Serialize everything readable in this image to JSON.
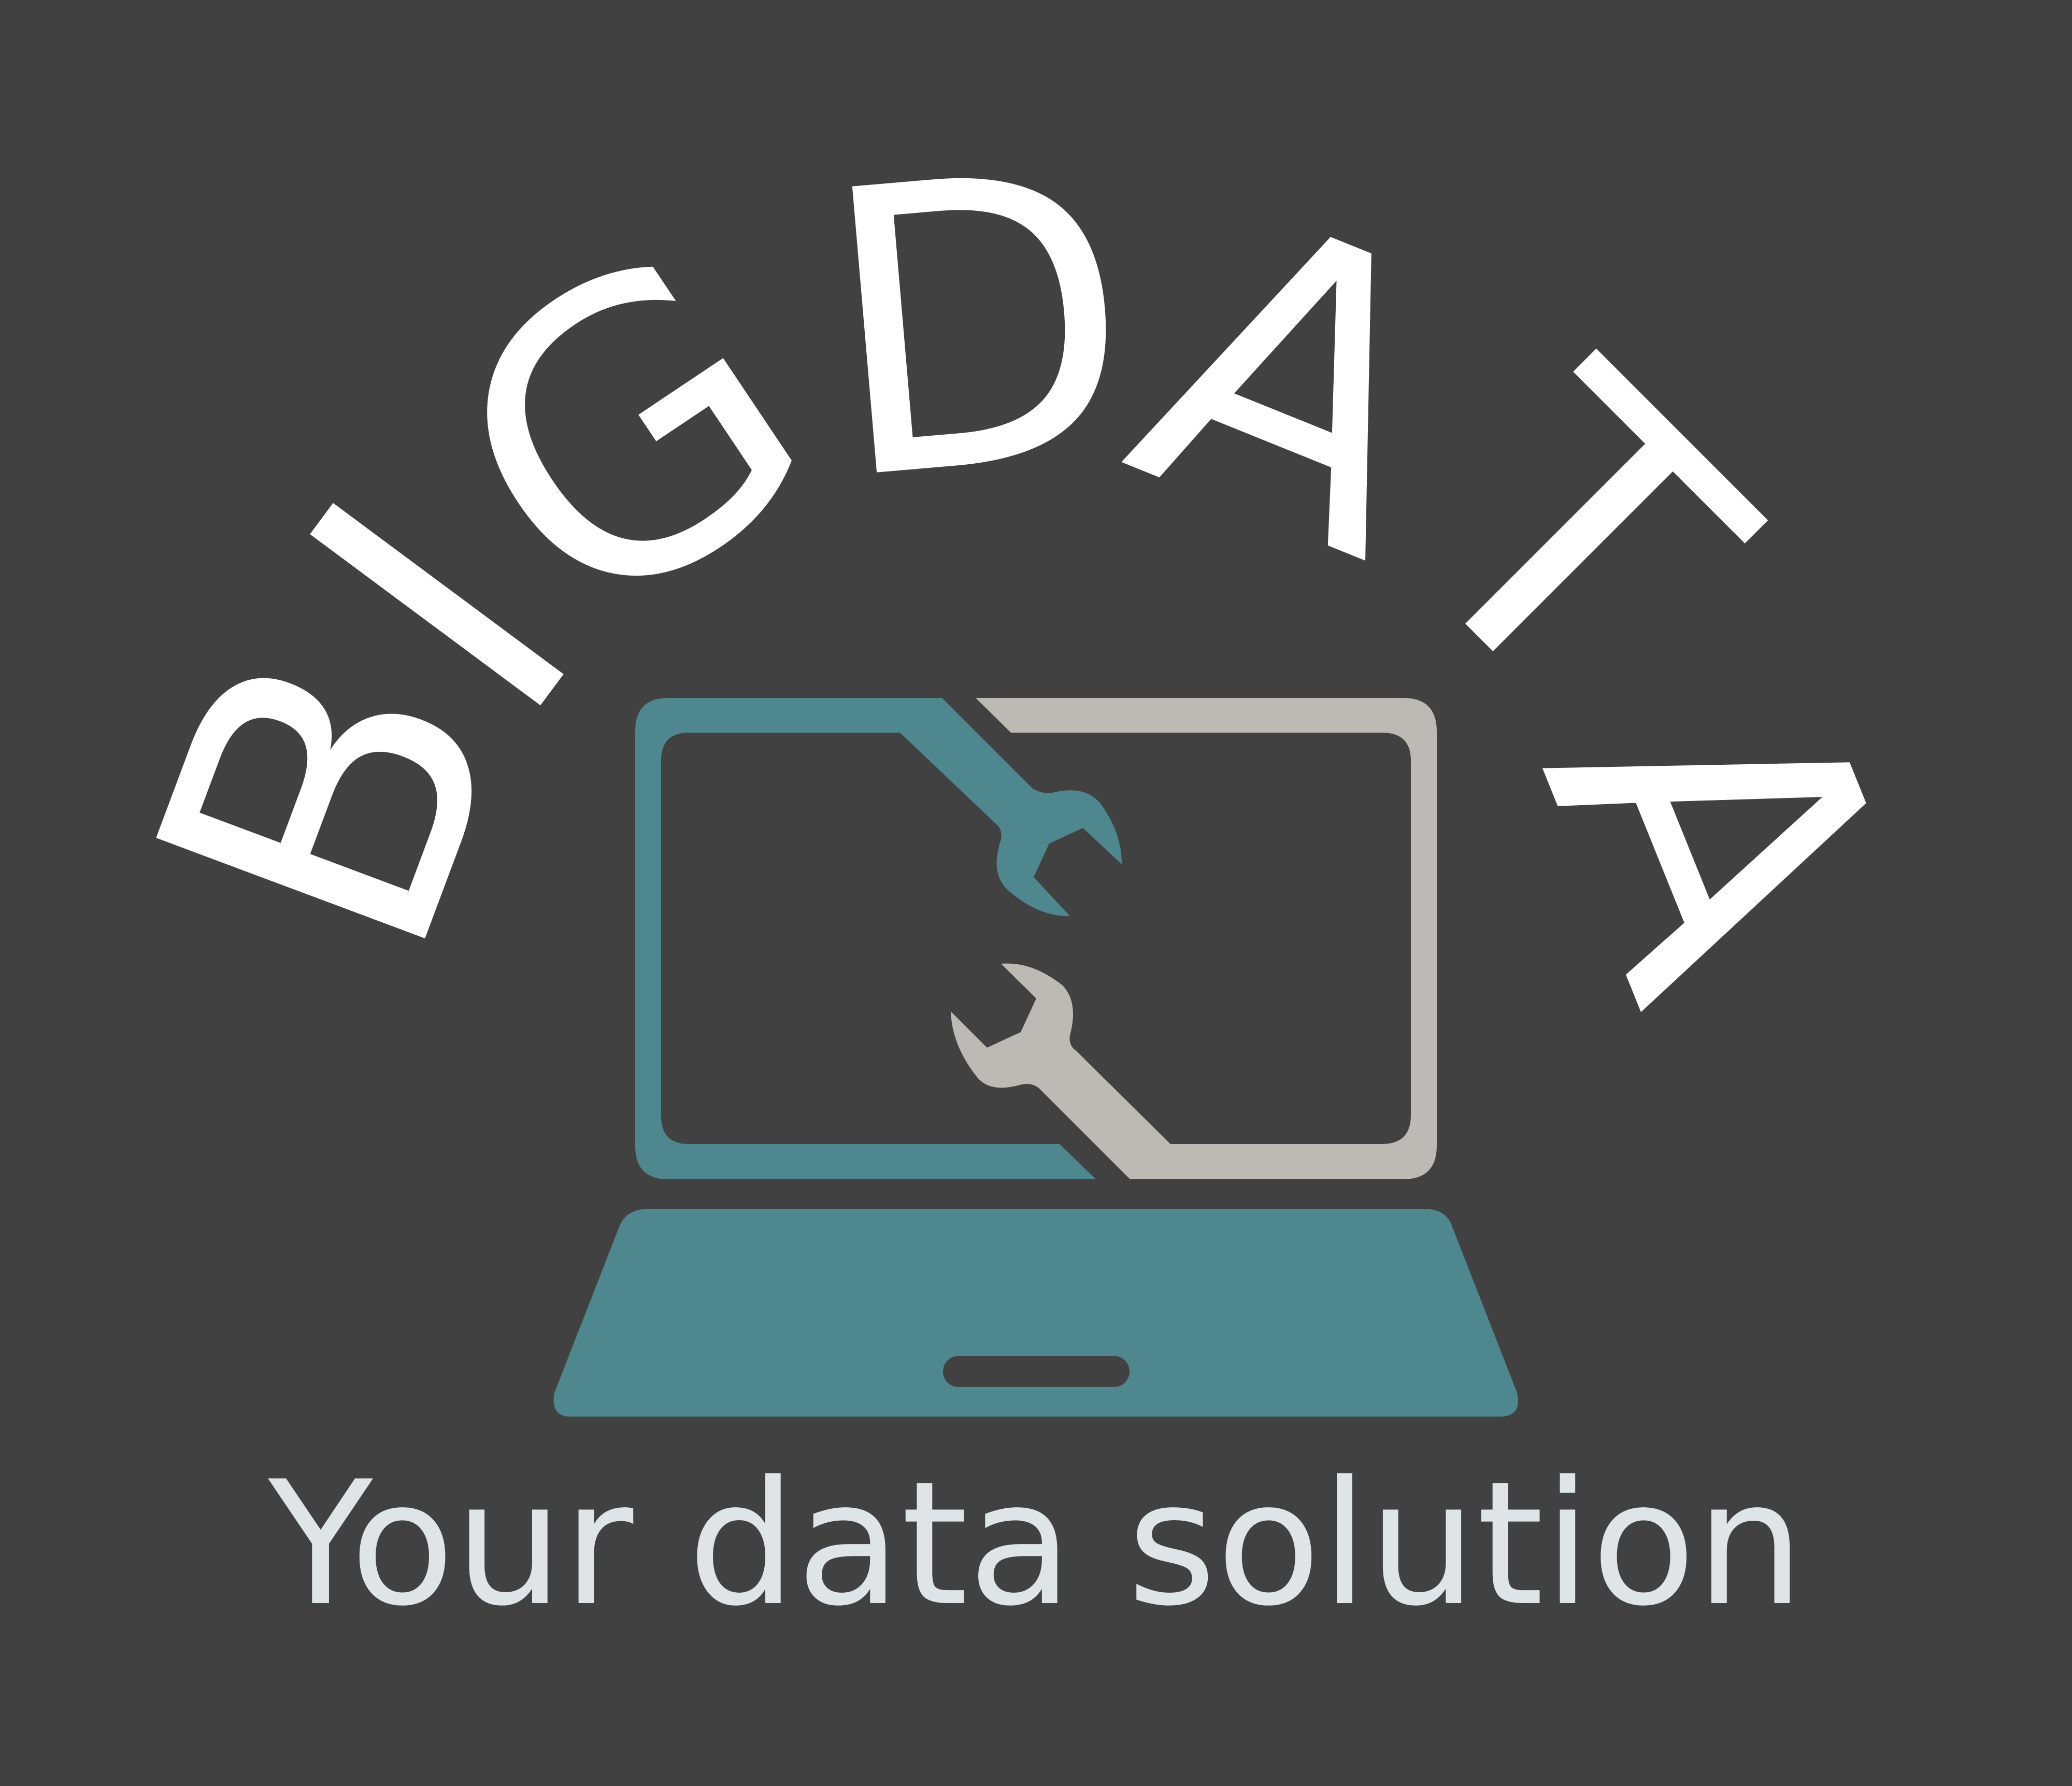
{
  "logo": {
    "wordmark": "BIGDATA",
    "letters": [
      "B",
      "I",
      "G",
      "D",
      "A",
      "T",
      "A"
    ],
    "tagline": "Your data solution"
  },
  "colors": {
    "background": "#414141",
    "wordmark": "#ffffff",
    "teal": "#4e878d",
    "gray": "#bbbab5",
    "tagline": "#dfe4e6"
  },
  "icons": {
    "laptop": "laptop-icon",
    "wrench_teal": "wrench-icon",
    "wrench_gray": "wrench-icon"
  }
}
